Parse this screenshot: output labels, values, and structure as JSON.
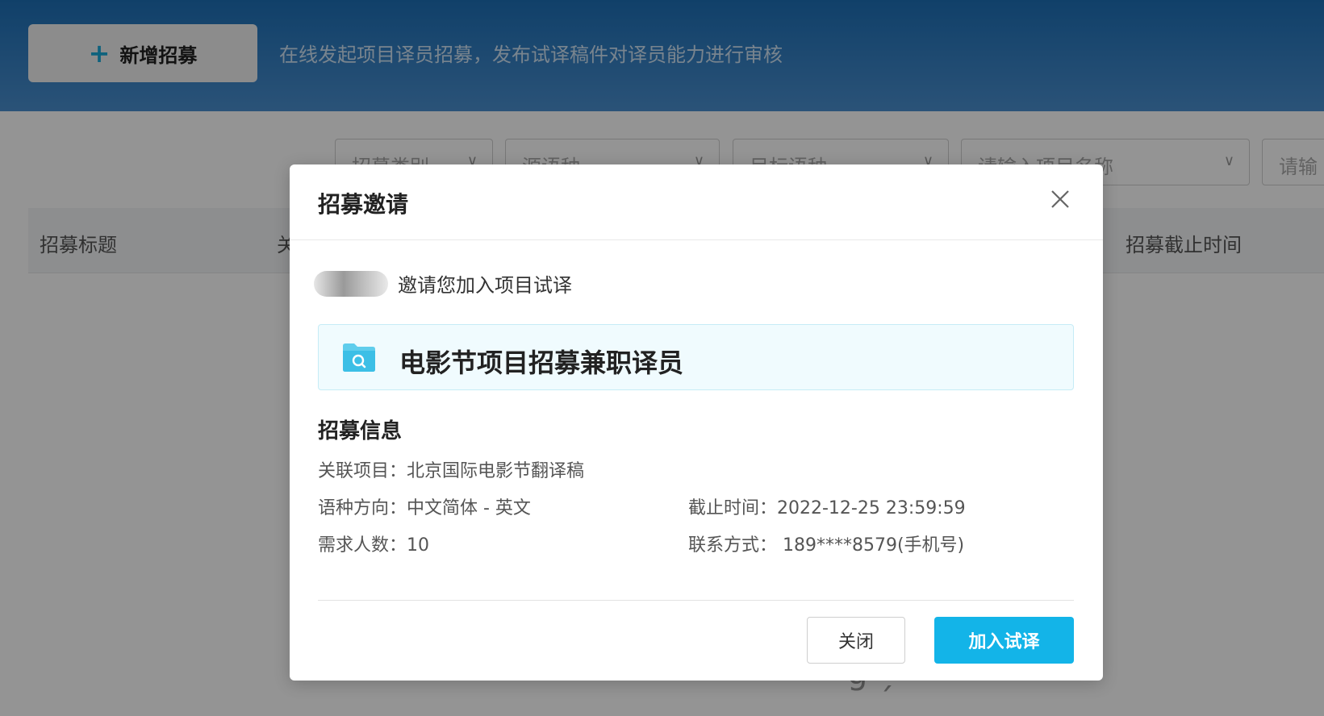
{
  "background": {
    "add_button_label": "新增招募",
    "top_description": "在线发起项目译员招募，发布试译稿件对译员能力进行审核",
    "filters": {
      "category": "招募类别",
      "source_lang": "源语种",
      "target_lang": "目标语种",
      "project_name_placeholder": "请输入项目名称",
      "extra": "请输"
    },
    "table_headers": {
      "title": "招募标题",
      "partial": "关",
      "deadline": "招募截止时间"
    }
  },
  "modal": {
    "title": "招募邀请",
    "inviter_text": "邀请您加入项目试译",
    "project_title": "电影节项目招募兼职译员",
    "section_title": "招募信息",
    "info": {
      "related_project": "关联项目：北京国际电影节翻译稿",
      "language_direction": "语种方向：中文简体 - 英文",
      "deadline": "截止时间：2022-12-25 23:59:59",
      "headcount": "需求人数：10",
      "contact": "联系方式： 189****8579(手机号)"
    },
    "buttons": {
      "close": "关闭",
      "join": "加入试译"
    }
  },
  "colors": {
    "accent": "#13b4e8",
    "topbar": "#1d6fb6"
  }
}
